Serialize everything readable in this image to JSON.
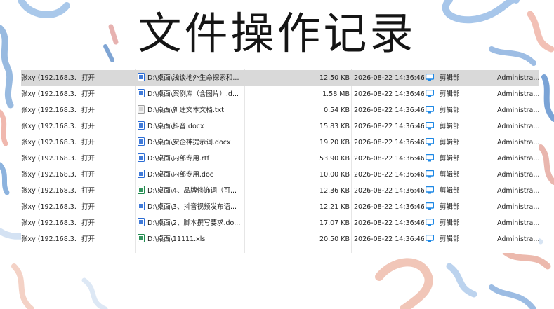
{
  "title": "文件操作记录",
  "colors": {
    "title": "#151515",
    "selected_row": "#d9d9d9",
    "pc_icon": "#1e88e5",
    "word_icon": "#2b6cd4",
    "excel_icon": "#1e8a4c",
    "txt_icon": "#9e9e9e"
  },
  "rows": [
    {
      "user": "张xy (192.168.3...",
      "action": "打开",
      "file_icon": "word-doc-icon",
      "file": "D:\\桌面\\浅谈地外生命探索和...",
      "size": "12.50 KB",
      "time": "2026-08-22 14:36:46",
      "computer_icon": "monitor-icon",
      "dept": "剪辑部",
      "admin": "Administra...",
      "selected": true
    },
    {
      "user": "张xy (192.168.3...",
      "action": "打开",
      "file_icon": "word-doc-icon",
      "file": "D:\\桌面\\案例库（含图片）.d...",
      "size": "1.58 MB",
      "time": "2026-08-22 14:36:46",
      "computer_icon": "monitor-icon",
      "dept": "剪辑部",
      "admin": "Administra..."
    },
    {
      "user": "张xy (192.168.3...",
      "action": "打开",
      "file_icon": "txt-doc-icon",
      "file": "D:\\桌面\\新建文本文档.txt",
      "size": "0.54 KB",
      "time": "2026-08-22 14:36:46",
      "computer_icon": "monitor-icon",
      "dept": "剪辑部",
      "admin": "Administra..."
    },
    {
      "user": "张xy (192.168.3...",
      "action": "打开",
      "file_icon": "word-doc-icon",
      "file": "D:\\桌面\\抖音.docx",
      "size": "15.83 KB",
      "time": "2026-08-22 14:36:46",
      "computer_icon": "monitor-icon",
      "dept": "剪辑部",
      "admin": "Administra..."
    },
    {
      "user": "张xy (192.168.3...",
      "action": "打开",
      "file_icon": "word-doc-icon",
      "file": "D:\\桌面\\安企神提示词.docx",
      "size": "19.20 KB",
      "time": "2026-08-22 14:36:46",
      "computer_icon": "monitor-icon",
      "dept": "剪辑部",
      "admin": "Administra..."
    },
    {
      "user": "张xy (192.168.3...",
      "action": "打开",
      "file_icon": "word-doc-icon",
      "file": "D:\\桌面\\内部专用.rtf",
      "size": "53.90 KB",
      "time": "2026-08-22 14:36:46",
      "computer_icon": "monitor-icon",
      "dept": "剪辑部",
      "admin": "Administra..."
    },
    {
      "user": "张xy (192.168.3...",
      "action": "打开",
      "file_icon": "word-doc-icon",
      "file": "D:\\桌面\\内部专用.doc",
      "size": "10.00 KB",
      "time": "2026-08-22 14:36:46",
      "computer_icon": "monitor-icon",
      "dept": "剪辑部",
      "admin": "Administra..."
    },
    {
      "user": "张xy (192.168.3...",
      "action": "打开",
      "file_icon": "excel-doc-icon",
      "file": "D:\\桌面\\4、品牌修饰词（可...",
      "size": "12.36 KB",
      "time": "2026-08-22 14:36:46",
      "computer_icon": "monitor-icon",
      "dept": "剪辑部",
      "admin": "Administra..."
    },
    {
      "user": "张xy (192.168.3...",
      "action": "打开",
      "file_icon": "word-doc-icon",
      "file": "D:\\桌面\\3、抖音视频发布语...",
      "size": "12.21 KB",
      "time": "2026-08-22 14:36:46",
      "computer_icon": "monitor-icon",
      "dept": "剪辑部",
      "admin": "Administra..."
    },
    {
      "user": "张xy (192.168.3...",
      "action": "打开",
      "file_icon": "word-doc-icon",
      "file": "D:\\桌面\\2、脚本撰写要求.do...",
      "size": "17.07 KB",
      "time": "2026-08-22 14:36:46",
      "computer_icon": "monitor-icon",
      "dept": "剪辑部",
      "admin": "Administra..."
    },
    {
      "user": "张xy (192.168.3...",
      "action": "打开",
      "file_icon": "excel-doc-icon",
      "file": "D:\\桌面\\11111.xls",
      "size": "20.50 KB",
      "time": "2026-08-22 14:36:46",
      "computer_icon": "monitor-icon",
      "dept": "剪辑部",
      "admin": "Administra..."
    }
  ]
}
